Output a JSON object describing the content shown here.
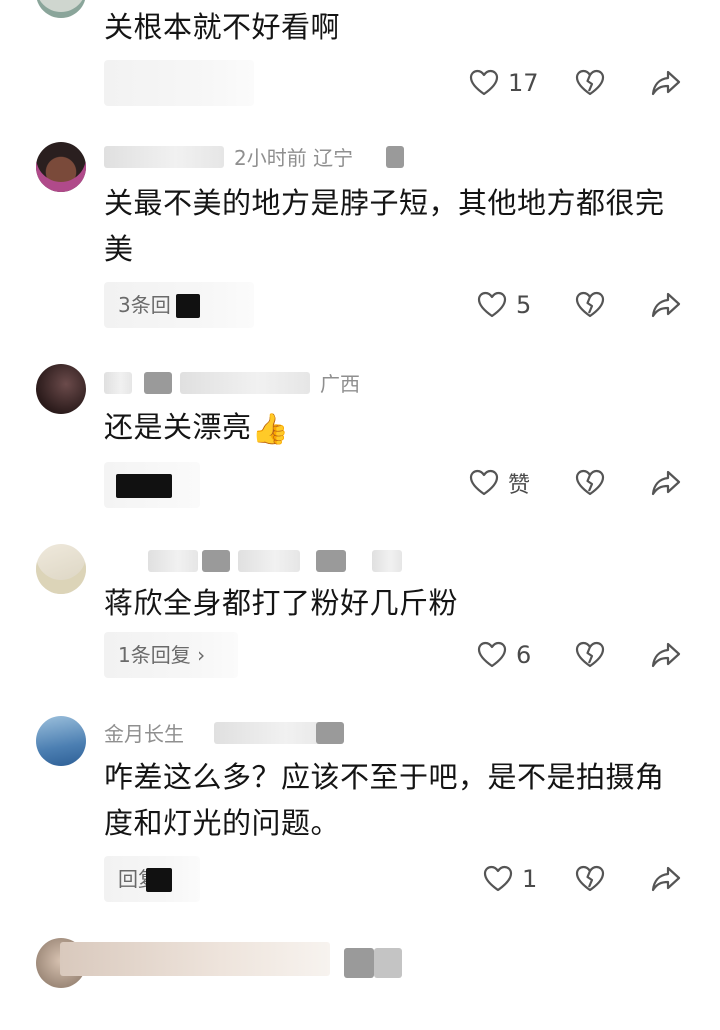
{
  "comments": [
    {
      "text": "关根本就不好看啊",
      "reply_label": "",
      "likes": "17"
    },
    {
      "meta_visible": "2小时前  辽宁",
      "text": "关最不美的地方是脖子短，其他地方都很完美",
      "reply_label": "3条回",
      "likes": "5"
    },
    {
      "meta_visible": "广西",
      "text": "还是关漂亮",
      "reply_label": "",
      "likes": "赞"
    },
    {
      "text": "蒋欣全身都打了粉好几斤粉",
      "reply_label": "1条回复 ›",
      "likes": "6"
    },
    {
      "meta_visible": "金月长生",
      "text": "咋差这么多？应该不至于吧，是不是拍摄角度和灯光的问题。",
      "reply_label": "回复",
      "likes": "1"
    }
  ],
  "icons": {
    "like": "heart-outline-icon",
    "dislike": "broken-heart-icon",
    "share": "share-arrow-icon"
  },
  "colors": {
    "text": "#141414",
    "meta": "#9c9c9c",
    "icon": "#555555"
  }
}
